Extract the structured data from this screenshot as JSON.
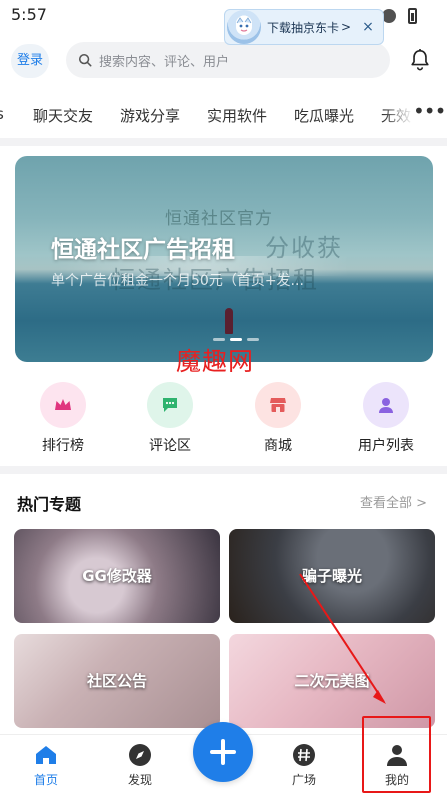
{
  "status_bar": {
    "time": "5:57"
  },
  "ad_pill": {
    "text": "下载抽京东卡",
    "arrow": ">",
    "close": "×"
  },
  "header": {
    "login_label": "登录",
    "search_placeholder": "搜索内容、评论、用户"
  },
  "tabs": {
    "items": [
      "s",
      "聊天交友",
      "游戏分享",
      "实用软件",
      "吃瓜曝光",
      "无效"
    ],
    "more": "•••"
  },
  "banner": {
    "title": "恒通社区广告招租",
    "subtitle": "单个广告位租金一个月50元（首页+发...",
    "watermark_top": "恒通社区官方",
    "watermark_mid": "分收获",
    "watermark_low": "恒通社区广告招租",
    "slide_count": 3,
    "active_slide": 2
  },
  "watermark_text": "魔趣网",
  "quick_links": [
    {
      "label": "排行榜",
      "icon": "crown-icon",
      "bg": "#fde4ef",
      "color": "#e0357f"
    },
    {
      "label": "评论区",
      "icon": "comment-icon",
      "bg": "#dff5ea",
      "color": "#2fb36f"
    },
    {
      "label": "商城",
      "icon": "shop-icon",
      "bg": "#fde3e2",
      "color": "#e45b5b"
    },
    {
      "label": "用户列表",
      "icon": "user-icon",
      "bg": "#ece4fb",
      "color": "#8a62e0"
    }
  ],
  "hot_topics": {
    "title": "热门专题",
    "more_label": "查看全部",
    "more_arrow": ">",
    "cards": [
      "GG修改器",
      "骗子曝光",
      "社区公告",
      "二次元美图"
    ]
  },
  "bottom_nav": {
    "items": [
      {
        "label": "首页",
        "icon": "home-icon",
        "active": true
      },
      {
        "label": "发现",
        "icon": "compass-icon",
        "active": false
      },
      {
        "label": "广场",
        "icon": "hashtag-icon",
        "active": false
      },
      {
        "label": "我的",
        "icon": "profile-icon",
        "active": false
      }
    ]
  },
  "colors": {
    "accent": "#1f7ee8",
    "annotation": "#e81818"
  }
}
